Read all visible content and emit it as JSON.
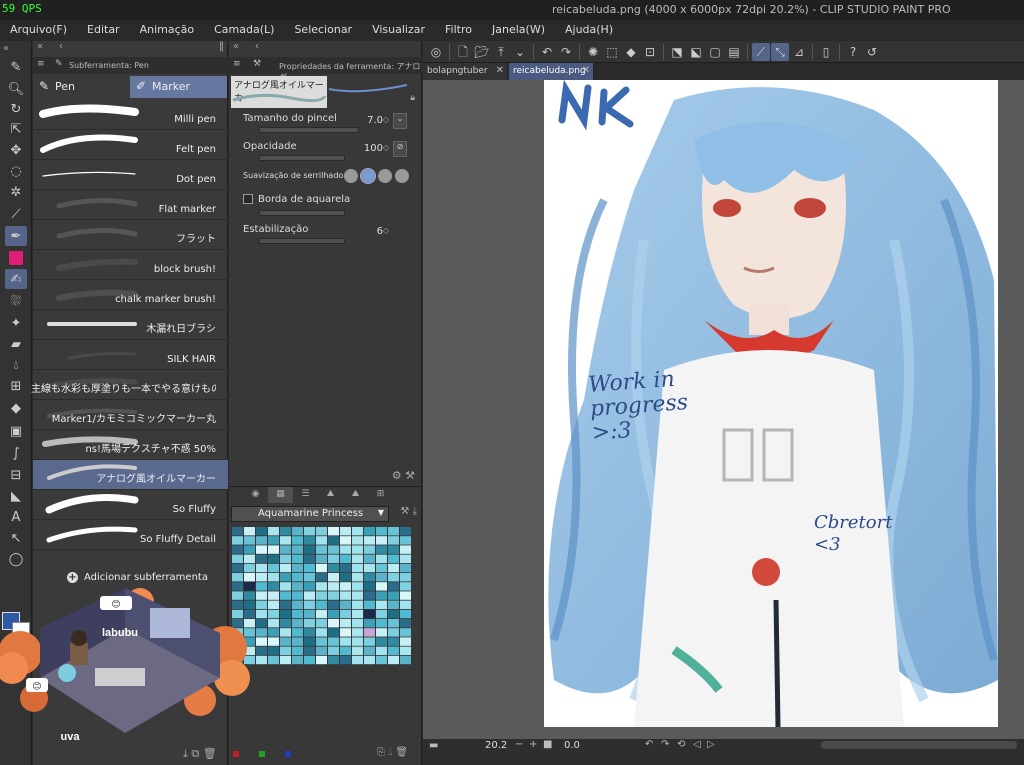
{
  "window": {
    "fps": "59 QPS",
    "title": "reicabeluda.png (4000 x 6000px 72dpi 20.2%) - CLIP STUDIO PAINT PRO"
  },
  "menu": [
    "Arquivo(F)",
    "Editar",
    "Animação",
    "Camada(L)",
    "Selecionar",
    "Visualizar",
    "Filtro",
    "Janela(W)",
    "Ajuda(H)"
  ],
  "colors": {
    "main": "#2b5aa6",
    "sub": "#ffffff",
    "accent": "#5a6a8e"
  },
  "subtool": {
    "tab_label": "Subferramenta: Pen",
    "groups": [
      {
        "label": "Pen",
        "icon": "pen-icon"
      },
      {
        "label": "Marker",
        "icon": "marker-icon",
        "selected": true
      }
    ],
    "brushes": [
      "Milli pen",
      "Felt pen",
      "Dot pen",
      "Flat marker",
      "フラット",
      "block brush!",
      "chalk marker brush!",
      "木漏れ日ブラシ",
      "SILK  HAIR",
      "主線も水彩も厚塗りも一本でやる意けものブ",
      "Marker1/カモミコミックマーカー丸",
      "ns!馬場テクスチャ不惑 50%",
      "アナログ風オイルマーカー",
      "So Fluffy",
      "So Fluffy Detail"
    ],
    "selected_index": 12,
    "add_label": "Adicionar subferramenta"
  },
  "overlay": {
    "user1": "labubu",
    "user2": "uva"
  },
  "toolprop": {
    "tab_label": "Propriedades da ferramenta: アナログ",
    "brush_name": "アナログ風オイルマーカー",
    "brush_size": {
      "label": "Tamanho do pincel",
      "value": "7.0"
    },
    "opacity": {
      "label": "Opacidade",
      "value": "100"
    },
    "smoothing": {
      "label": "Suavização de serrilhado"
    },
    "watercolor_edge": {
      "label": "Borda de aquarela",
      "checked": false
    },
    "stabilization": {
      "label": "Estabilização",
      "value": "6"
    }
  },
  "colorset": {
    "set_name": "Aquamarine Princess"
  },
  "doc_tabs": [
    {
      "label": "bolapngtuber",
      "active": false
    },
    {
      "label": "reicabeluda.png",
      "active": true
    }
  ],
  "canvas_text": {
    "wip": "Work in progress >:3",
    "signature": "Cbretort <3",
    "initials": "NK"
  },
  "status": {
    "zoom": "20.2",
    "rotation": "0.0"
  }
}
